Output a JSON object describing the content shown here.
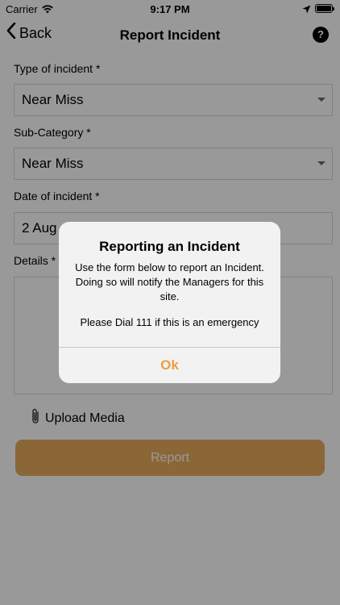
{
  "status_bar": {
    "carrier": "Carrier",
    "time": "9:17 PM",
    "icons": [
      "wifi-icon",
      "location-icon",
      "battery-icon"
    ]
  },
  "nav": {
    "back_label": "Back",
    "title": "Report Incident",
    "help_label": "?"
  },
  "form": {
    "type_label": "Type of incident *",
    "type_value": "Near Miss",
    "subcategory_label": "Sub-Category *",
    "subcategory_value": "Near Miss",
    "date_label": "Date of incident *",
    "date_value": "2 Aug",
    "details_label": "Details *",
    "upload_label": "Upload Media",
    "report_label": "Report"
  },
  "alert": {
    "title": "Reporting an Incident",
    "message": "Use the form below to report an Incident. Doing so will notify the Managers for this site.",
    "emergency": "Please Dial 111 if this is an emergency",
    "ok_label": "Ok"
  },
  "colors": {
    "accent": "#e8a040",
    "report_button": "#e8ac5e",
    "overlay": "rgba(0,0,0,0.4)"
  }
}
